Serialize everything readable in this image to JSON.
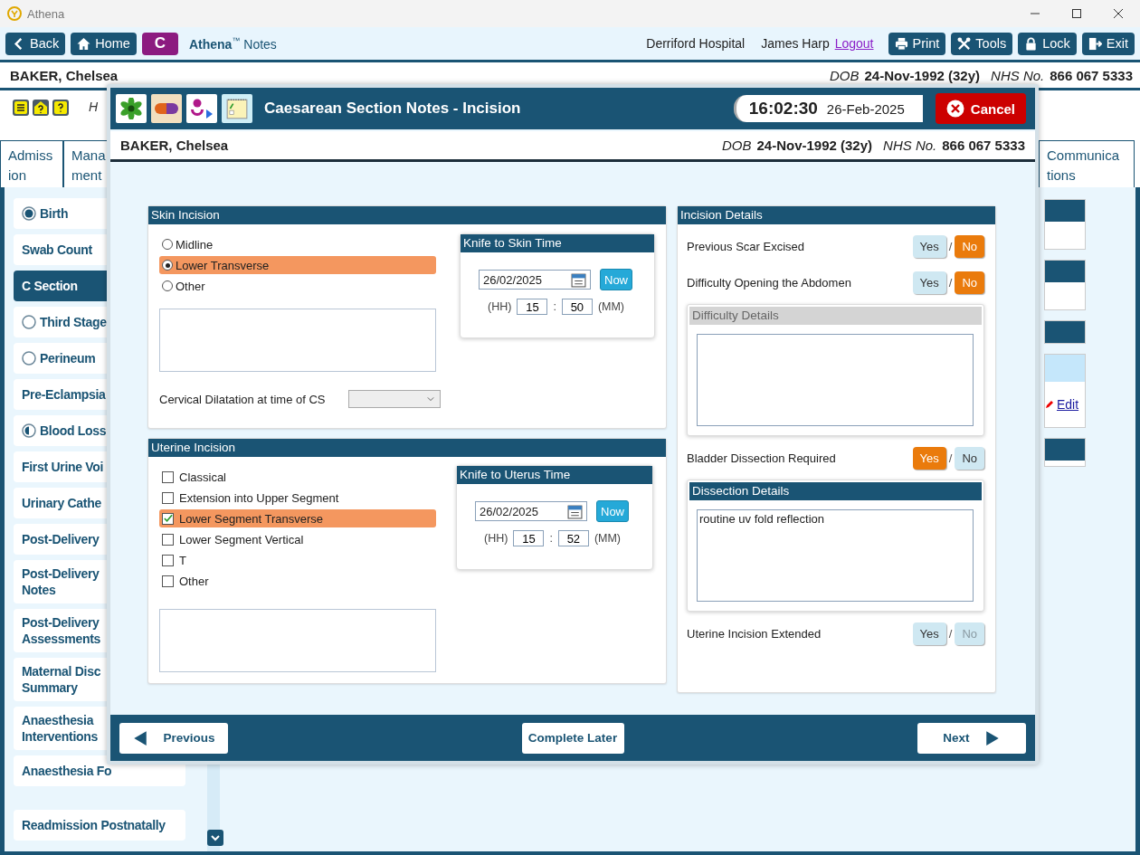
{
  "window": {
    "title": "Athena"
  },
  "toolbar": {
    "nav": [
      {
        "label": "Back",
        "kind": "back"
      },
      {
        "label": "Home",
        "kind": "home"
      },
      {
        "label": "C",
        "kind": "badge"
      }
    ],
    "brand": "Athena",
    "brand_mark": "™",
    "app_name": "Notes",
    "location": "Derriford Hospital",
    "user": "James Harp",
    "logout": "Logout",
    "actions": [
      {
        "label": "Print",
        "kind": "print"
      },
      {
        "label": "Tools",
        "kind": "tools"
      },
      {
        "label": "Lock",
        "kind": "lock"
      },
      {
        "label": "Exit",
        "kind": "exit"
      }
    ]
  },
  "patient": {
    "name": "BAKER, Chelsea",
    "dob_label": "DOB",
    "dob": "24-Nov-1992 (32y)",
    "nhs_label": "NHS No.",
    "nhs": "866 067 5333"
  },
  "info_text": "H",
  "tabs": [
    {
      "lines": [
        "Admiss",
        "ion"
      ],
      "selected": false
    },
    {
      "lines": [
        "Mana",
        "ment"
      ],
      "selected": false
    },
    {
      "lines": [
        "Communica",
        "tions"
      ],
      "selected": false
    }
  ],
  "sidebar": {
    "items": [
      {
        "lines": [
          "Birth"
        ],
        "kind": "complete",
        "selected": false
      },
      {
        "lines": [
          "Swab Count"
        ],
        "kind": "plain",
        "selected": false
      },
      {
        "lines": [
          "C Section"
        ],
        "kind": "plain",
        "selected": true
      },
      {
        "lines": [
          "Third Stage"
        ],
        "kind": "empty",
        "selected": false
      },
      {
        "lines": [
          "Perineum"
        ],
        "kind": "empty",
        "selected": false
      },
      {
        "lines": [
          "Pre-Eclampsia"
        ],
        "kind": "plain",
        "selected": false
      },
      {
        "lines": [
          "Blood Loss"
        ],
        "kind": "partial",
        "selected": false
      },
      {
        "lines": [
          "First Urine Voi"
        ],
        "kind": "plain",
        "selected": false
      },
      {
        "lines": [
          "Urinary Cathe"
        ],
        "kind": "plain",
        "selected": false
      },
      {
        "lines": [
          "Post-Delivery"
        ],
        "kind": "plain",
        "selected": false
      },
      {
        "lines": [
          "Post-Delivery",
          "Notes"
        ],
        "kind": "plain",
        "selected": false
      },
      {
        "lines": [
          "Post-Delivery",
          "Assessments"
        ],
        "kind": "plain",
        "selected": false
      },
      {
        "lines": [
          "Maternal Disc",
          "Summary"
        ],
        "kind": "plain",
        "selected": false
      },
      {
        "lines": [
          "Anaesthesia",
          "Interventions"
        ],
        "kind": "plain",
        "selected": false
      },
      {
        "lines": [
          "Anaesthesia Fo"
        ],
        "kind": "plain",
        "selected": false
      },
      {
        "lines": [
          "Readmission Postnatally"
        ],
        "kind": "plain",
        "selected": false
      }
    ]
  },
  "side_panels": {
    "edit_link": "Edit"
  },
  "modal": {
    "title": "Caesarean Section Notes - Incision",
    "time": "16:02:30",
    "date": "26-Feb-2025",
    "cancel": "Cancel",
    "patient": {
      "name": "BAKER, Chelsea",
      "dob_label": "DOB",
      "dob": "24-Nov-1992 (32y)",
      "nhs_label": "NHS No.",
      "nhs": "866 067 5333"
    },
    "skin_incision": {
      "title": "Skin Incision",
      "options": [
        {
          "label": "Midline",
          "selected": false
        },
        {
          "label": "Lower Transverse",
          "selected": true
        },
        {
          "label": "Other",
          "selected": false
        }
      ],
      "cervical_label": "Cervical Dilatation at time of CS",
      "time": {
        "title": "Knife to Skin Time",
        "date": "26/02/2025",
        "now": "Now",
        "hh_label": "(HH)",
        "hh": "15",
        "separator": ":",
        "mm": "50",
        "mm_label": "(MM)"
      }
    },
    "uterine_incision": {
      "title": "Uterine Incision",
      "options": [
        {
          "label": "Classical",
          "checked": false
        },
        {
          "label": "Extension into Upper Segment",
          "checked": false
        },
        {
          "label": "Lower Segment Transverse",
          "checked": true
        },
        {
          "label": "Lower Segment Vertical",
          "checked": false
        },
        {
          "label": "T",
          "checked": false
        },
        {
          "label": "Other",
          "checked": false
        }
      ],
      "time": {
        "title": "Knife to Uterus Time",
        "date": "26/02/2025",
        "now": "Now",
        "hh_label": "(HH)",
        "hh": "15",
        "separator": ":",
        "mm": "52",
        "mm_label": "(MM)"
      }
    },
    "incision_details": {
      "title": "Incision Details",
      "items": [
        {
          "kind": "question",
          "label": "Previous Scar Excised",
          "separator": "/",
          "options": [
            {
              "label": "Yes",
              "selected": false,
              "disabled": false
            },
            {
              "label": "No",
              "selected": true,
              "disabled": false
            }
          ]
        },
        {
          "kind": "question",
          "label": "Difficulty Opening the Abdomen",
          "separator": "/",
          "options": [
            {
              "label": "Yes",
              "selected": false,
              "disabled": false
            },
            {
              "label": "No",
              "selected": true,
              "disabled": false
            }
          ]
        },
        {
          "kind": "details",
          "title": "Difficulty Details",
          "disabled": true
        },
        {
          "kind": "question",
          "label": "Bladder Dissection Required",
          "separator": "/",
          "options": [
            {
              "label": "Yes",
              "selected": true,
              "disabled": false
            },
            {
              "label": "No",
              "selected": false,
              "disabled": false
            }
          ]
        },
        {
          "kind": "details",
          "title": "Dissection Details",
          "disabled": false,
          "value": "routine uv fold reflection"
        },
        {
          "kind": "question",
          "label": "Uterine Incision Extended",
          "separator": "/",
          "options": [
            {
              "label": "Yes",
              "selected": false,
              "disabled": false
            },
            {
              "label": "No",
              "selected": false,
              "disabled": true
            }
          ]
        }
      ]
    },
    "footer": {
      "previous": "Previous",
      "complete_later": "Complete Later",
      "next": "Next"
    }
  }
}
